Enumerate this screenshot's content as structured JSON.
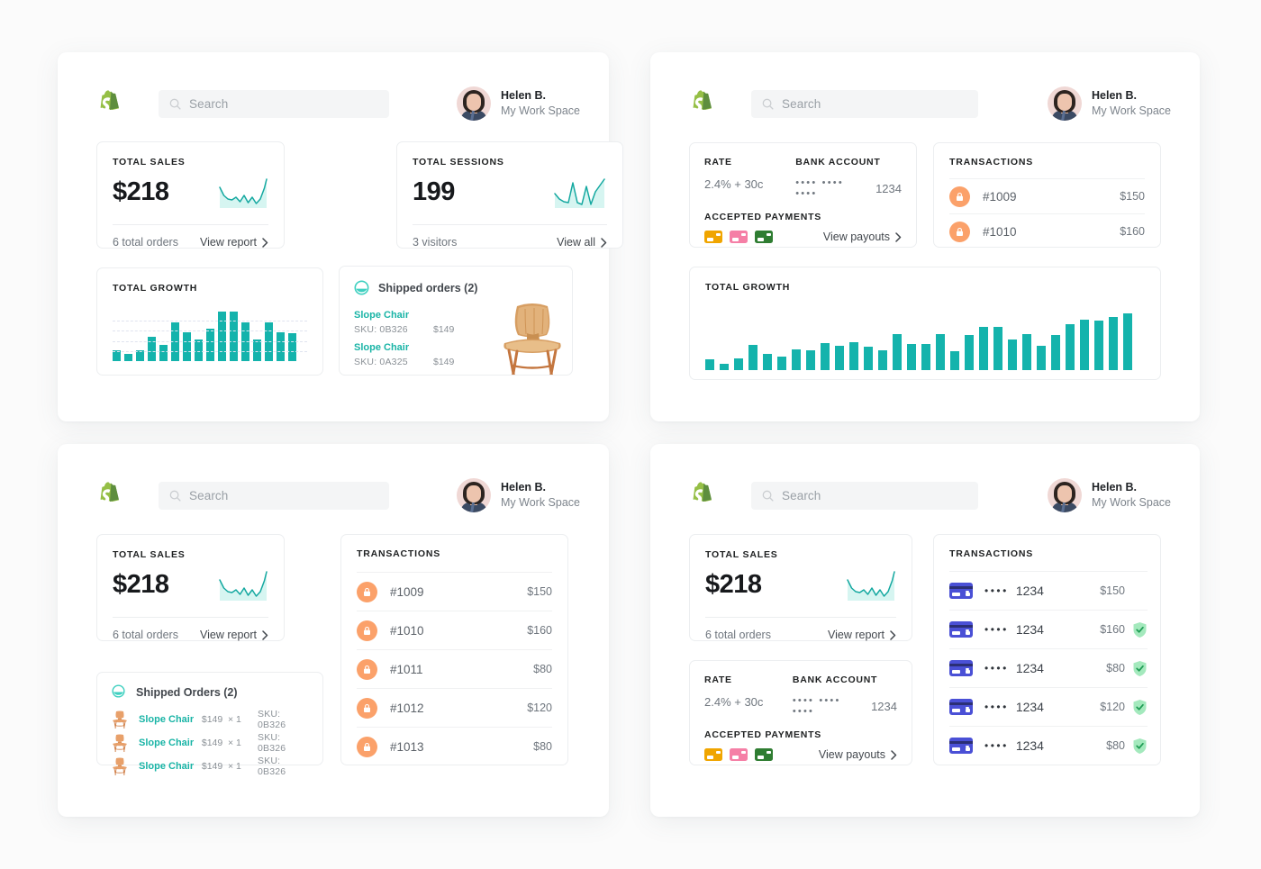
{
  "brand": {
    "logo_icon": "shopify-bag-icon",
    "accent_teal": "#14b3ac",
    "accent_green": "#95bf46",
    "accent_orange": "#fba16a",
    "accent_blue": "#4a50d6"
  },
  "header": {
    "search_placeholder": "Search",
    "search_value": "",
    "user_name": "Helen B.",
    "workspace": "My Work Space"
  },
  "panels": {
    "top_left": {
      "total_sales": {
        "label": "TOTAL SALES",
        "value": "$218",
        "sub": "6 total orders",
        "action": "View report"
      },
      "total_sessions": {
        "label": "TOTAL SESSIONS",
        "value": "199",
        "sub": "3 visitors",
        "action": "View all"
      },
      "total_growth": {
        "label": "TOTAL GROWTH"
      },
      "shipped": {
        "title": "Shipped orders (2)",
        "items": [
          {
            "name": "Slope Chair",
            "sku": "SKU: 0B326",
            "price": "$149"
          },
          {
            "name": "Slope Chair",
            "sku": "SKU: 0A325",
            "price": "$149"
          }
        ]
      }
    },
    "top_right": {
      "payments": {
        "rate_label": "RATE",
        "rate_value": "2.4% + 30c",
        "bank_label": "BANK ACCOUNT",
        "bank_dots": "•••• •••• ••••",
        "bank_last4": "1234",
        "accepted_label": "ACCEPTED PAYMENTS",
        "action": "View payouts",
        "cards": [
          "orange-card-icon",
          "pink-card-icon",
          "green-card-icon"
        ]
      },
      "transactions": {
        "label": "TRANSACTIONS",
        "rows": [
          {
            "id": "#1009",
            "amount": "$150"
          },
          {
            "id": "#1010",
            "amount": "$160"
          }
        ]
      },
      "total_growth": {
        "label": "TOTAL GROWTH"
      }
    },
    "bottom_left": {
      "total_sales": {
        "label": "TOTAL SALES",
        "value": "$218",
        "sub": "6 total orders",
        "action": "View report"
      },
      "shipped": {
        "title": "Shipped Orders (2)",
        "items": [
          {
            "name": "Slope Chair",
            "price": "$149",
            "qty": "× 1",
            "sku": "SKU: 0B326"
          },
          {
            "name": "Slope Chair",
            "price": "$149",
            "qty": "× 1",
            "sku": "SKU: 0B326"
          },
          {
            "name": "Slope Chair",
            "price": "$149",
            "qty": "× 1",
            "sku": "SKU: 0B326"
          }
        ]
      },
      "transactions": {
        "label": "TRANSACTIONS",
        "rows": [
          {
            "id": "#1009",
            "amount": "$150"
          },
          {
            "id": "#1010",
            "amount": "$160"
          },
          {
            "id": "#1011",
            "amount": "$80"
          },
          {
            "id": "#1012",
            "amount": "$120"
          },
          {
            "id": "#1013",
            "amount": "$80"
          }
        ]
      }
    },
    "bottom_right": {
      "total_sales": {
        "label": "TOTAL SALES",
        "value": "$218",
        "sub": "6 total orders",
        "action": "View report"
      },
      "payments": {
        "rate_label": "RATE",
        "rate_value": "2.4% + 30c",
        "bank_label": "BANK ACCOUNT",
        "bank_dots": "•••• •••• ••••",
        "bank_last4": "1234",
        "accepted_label": "ACCEPTED PAYMENTS",
        "action": "View payouts"
      },
      "transactions": {
        "label": "TRANSACTIONS",
        "rows": [
          {
            "dots": "••••",
            "last4": "1234",
            "amount": "$150",
            "verified": false
          },
          {
            "dots": "••••",
            "last4": "1234",
            "amount": "$160",
            "verified": true
          },
          {
            "dots": "••••",
            "last4": "1234",
            "amount": "$80",
            "verified": true
          },
          {
            "dots": "••••",
            "last4": "1234",
            "amount": "$120",
            "verified": true
          },
          {
            "dots": "••••",
            "last4": "1234",
            "amount": "$80",
            "verified": true
          }
        ]
      }
    }
  },
  "chart_data": [
    {
      "id": "growth_small",
      "type": "bar",
      "title": "TOTAL GROWTH",
      "categories": [
        "1",
        "2",
        "3",
        "4",
        "5",
        "6",
        "7",
        "8",
        "9",
        "10",
        "11",
        "12",
        "13",
        "14",
        "15",
        "16"
      ],
      "values": [
        22,
        15,
        22,
        48,
        32,
        77,
        57,
        42,
        65,
        98,
        98,
        76,
        42,
        76,
        58,
        55
      ],
      "ylim": [
        0,
        100
      ],
      "grid": true,
      "xlabel": "",
      "ylabel": "",
      "color": "#14b3ac"
    },
    {
      "id": "growth_large",
      "type": "bar",
      "title": "TOTAL GROWTH",
      "categories": [
        "1",
        "2",
        "3",
        "4",
        "5",
        "6",
        "7",
        "8",
        "9",
        "10",
        "11",
        "12",
        "13",
        "14",
        "15",
        "16",
        "17",
        "18",
        "19",
        "20",
        "21",
        "22",
        "23",
        "24",
        "25",
        "26"
      ],
      "values": [
        17,
        10,
        18,
        40,
        26,
        22,
        33,
        32,
        43,
        38,
        44,
        37,
        31,
        57,
        42,
        42,
        57,
        30,
        56,
        69,
        69,
        48,
        57,
        38,
        56,
        73,
        80,
        79,
        85,
        90
      ],
      "ylim": [
        0,
        100
      ],
      "grid": false,
      "xlabel": "",
      "ylabel": "",
      "color": "#14b3ac"
    },
    {
      "id": "sparkline_sales",
      "type": "line",
      "title": "",
      "x": [
        0,
        1,
        2,
        3,
        4,
        5,
        6,
        7,
        8,
        9,
        10,
        11,
        12
      ],
      "values": [
        58,
        34,
        22,
        20,
        26,
        18,
        30,
        16,
        26,
        14,
        22,
        52,
        96
      ],
      "ylim": [
        0,
        100
      ],
      "color": "#14a8a0"
    },
    {
      "id": "sparkline_sessions",
      "type": "line",
      "title": "",
      "x": [
        0,
        1,
        2,
        3,
        4,
        5,
        6,
        7,
        8,
        9,
        10
      ],
      "values": [
        40,
        26,
        20,
        18,
        74,
        20,
        16,
        62,
        14,
        48,
        96
      ],
      "ylim": [
        0,
        100
      ],
      "color": "#14a8a0"
    }
  ]
}
